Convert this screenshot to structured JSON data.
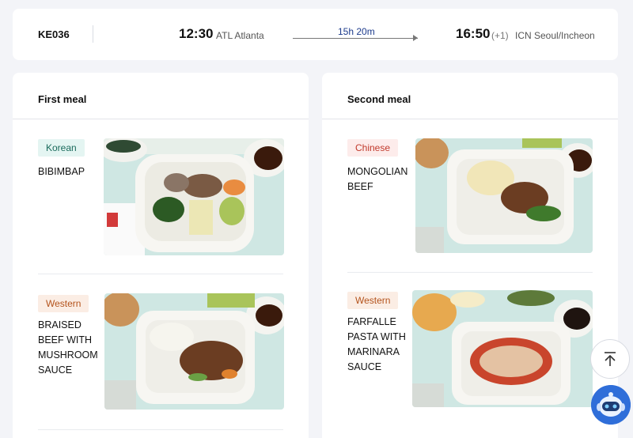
{
  "flight": {
    "number": "KE036",
    "departure_time": "12:30",
    "departure_airport": "ATL Atlanta",
    "duration": "15h 20m",
    "arrival_time": "16:50",
    "arrival_day_offset": "(+1)",
    "arrival_airport": "ICN Seoul/Incheon"
  },
  "meals": {
    "first": {
      "title": "First meal",
      "items": [
        {
          "cuisine": "Korean",
          "dish": "BIBIMBAP",
          "icon": "bibimbap-photo"
        },
        {
          "cuisine": "Western",
          "dish": "BRAISED BEEF WITH MUSHROOM SAUCE",
          "icon": "braised-beef-photo"
        }
      ]
    },
    "second": {
      "title": "Second meal",
      "items": [
        {
          "cuisine": "Chinese",
          "dish": "MONGOLIAN BEEF",
          "icon": "mongolian-beef-photo"
        },
        {
          "cuisine": "Western",
          "dish": "FARFALLE PASTA WITH MARINARA SAUCE",
          "icon": "farfalle-pasta-photo"
        }
      ]
    }
  },
  "floating": {
    "top_icon": "arrow-up-to-top-icon",
    "chatbot_icon": "chatbot-avatar-icon"
  },
  "colors": {
    "page_bg": "#f3f4f8",
    "duration_text": "#1d3b8c",
    "korean_tag_bg": "#e4f5f2",
    "chinese_tag_bg": "#fdeceb",
    "western_tag_bg": "#fbede4",
    "chatbot_bg": "#2f6ed9"
  }
}
